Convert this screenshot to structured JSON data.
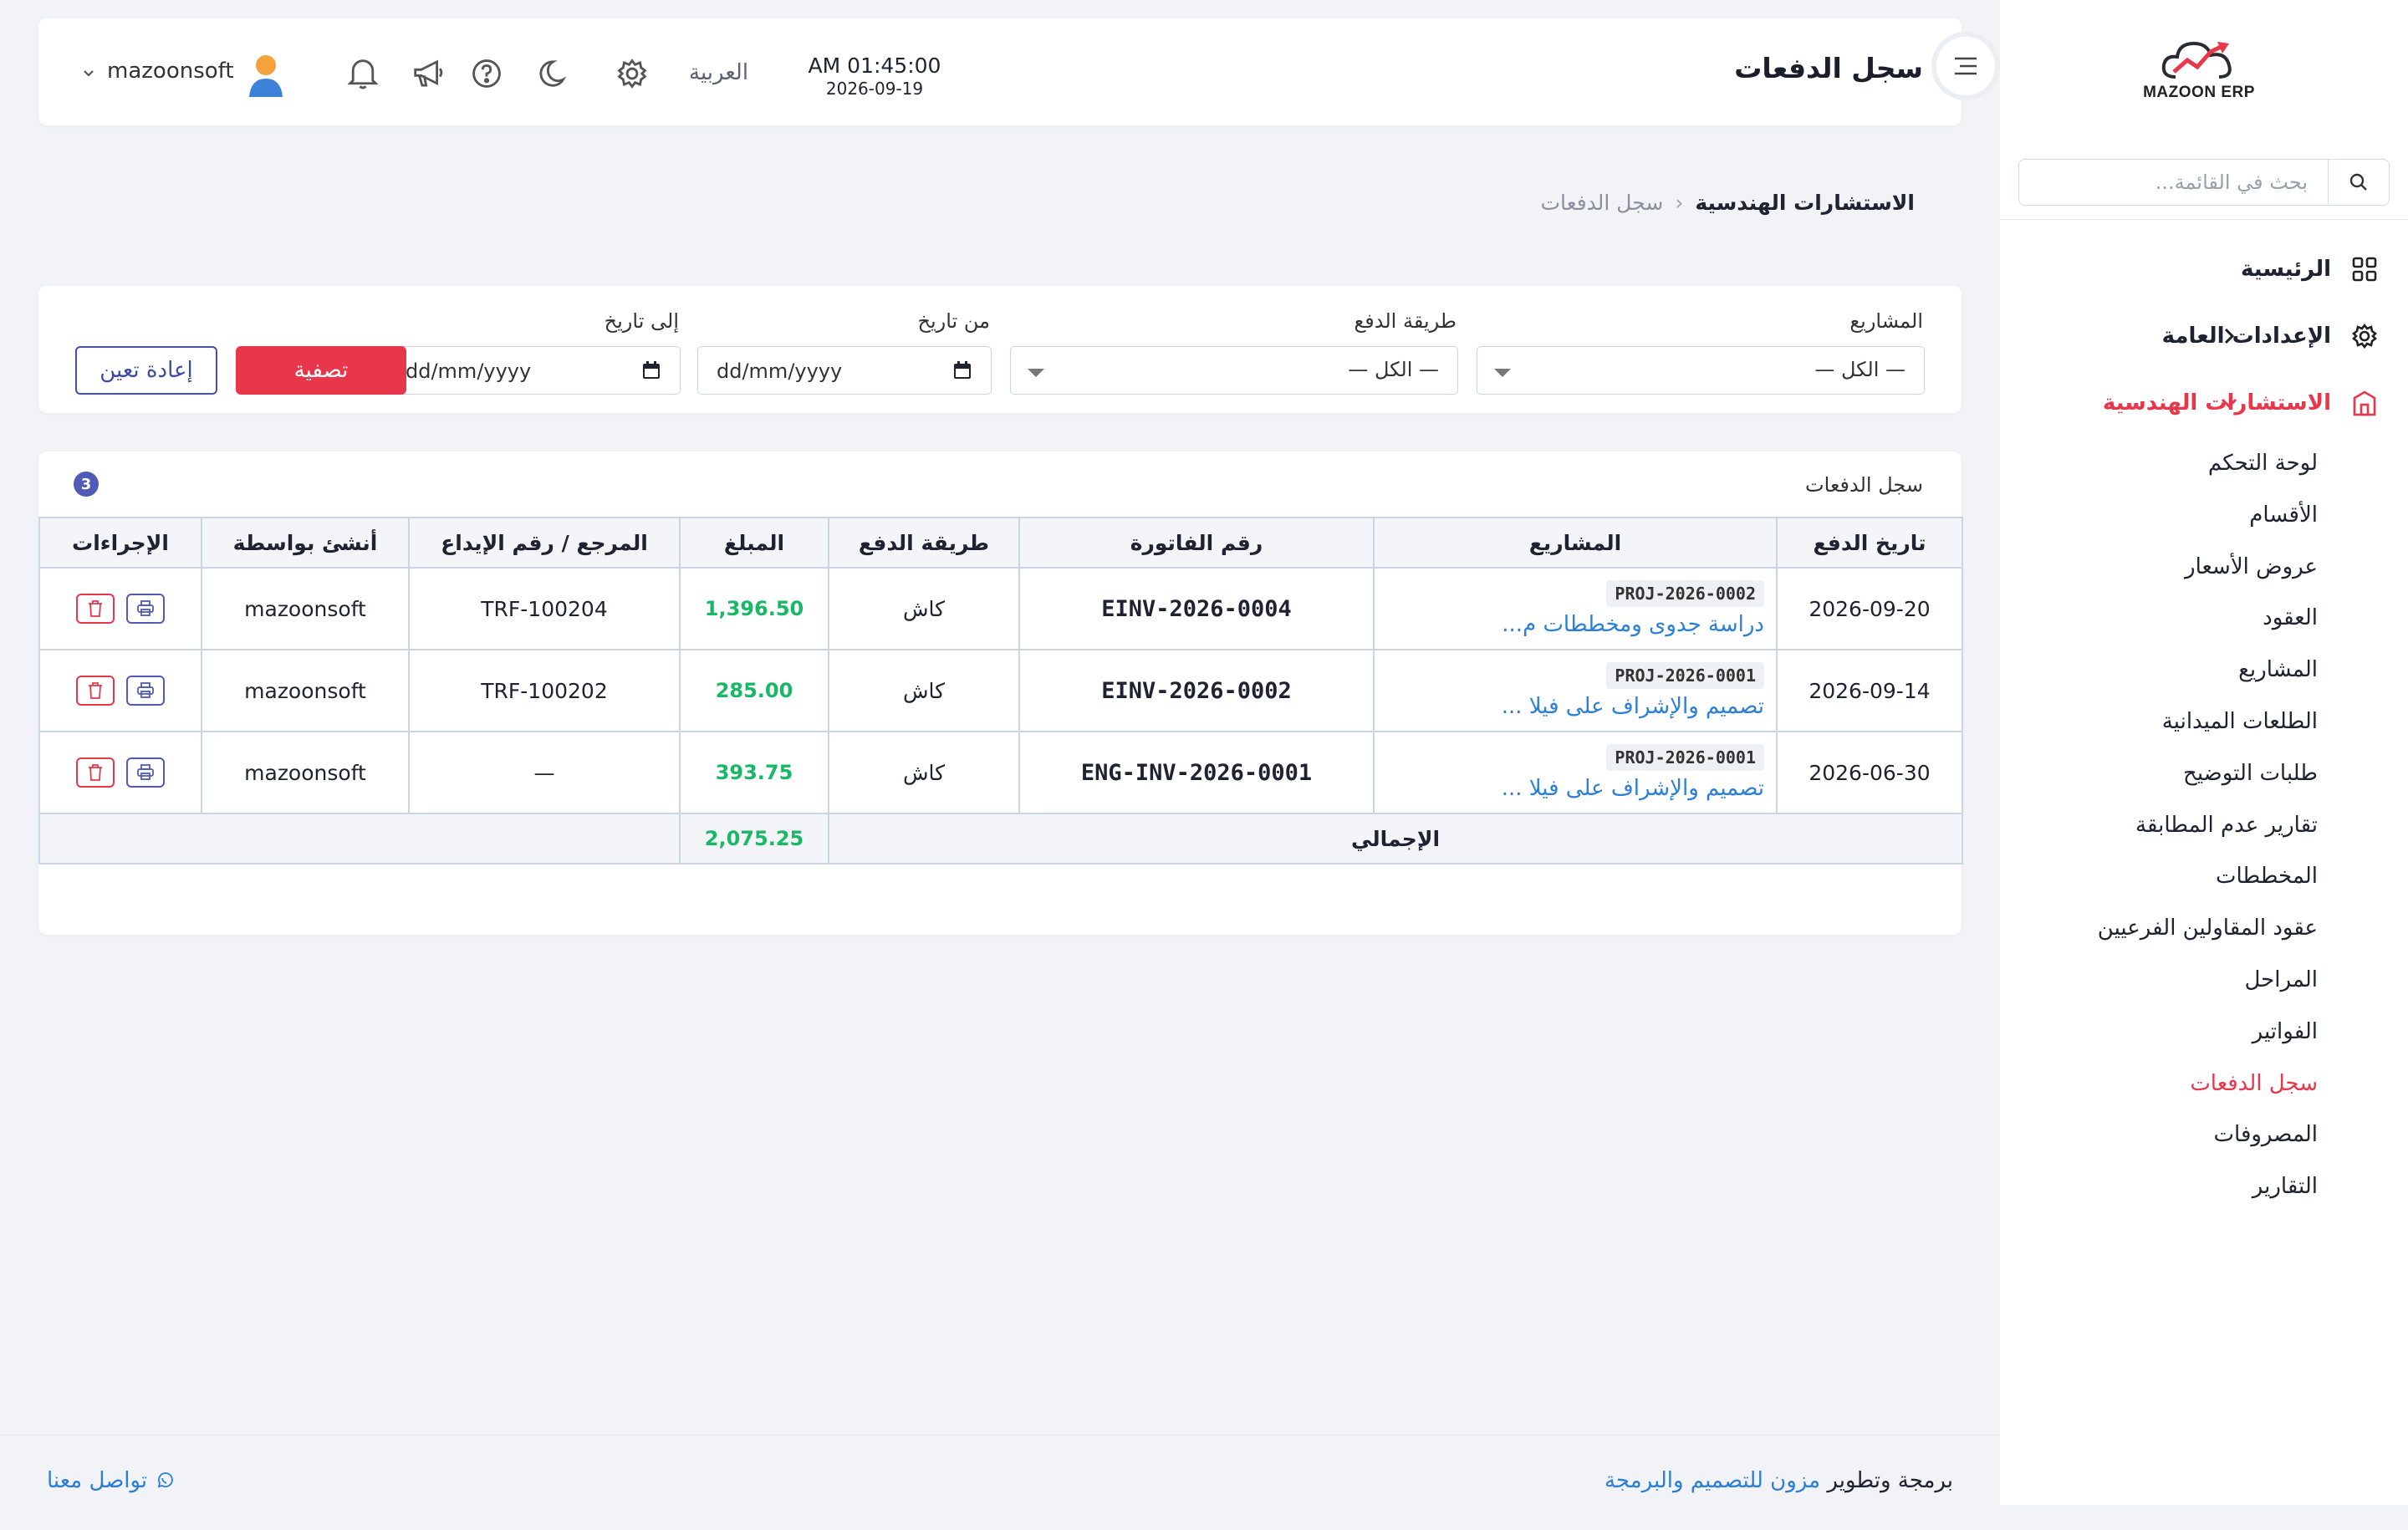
{
  "sidebar": {
    "logo_text": "MAZOON ERP",
    "search_placeholder": "بحث في القائمة...",
    "menu": [
      {
        "label": "الرئيسية",
        "icon": "grid-icon"
      },
      {
        "label": "الإعدادات العامة",
        "icon": "gear-icon"
      },
      {
        "label": "الاستشارات الهندسية",
        "icon": "building-icon"
      }
    ],
    "submenu": [
      "لوحة التحكم",
      "الأقسام",
      "عروض الأسعار",
      "العقود",
      "المشاريع",
      "الطلعات الميدانية",
      "طلبات التوضيح",
      "تقارير عدم المطابقة",
      "المخططات",
      "عقود المقاولين الفرعيين",
      "المراحل",
      "الفواتير",
      "سجل الدفعات",
      "المصروفات",
      "التقارير"
    ],
    "active_submenu_index": 12
  },
  "header": {
    "title": "سجل الدفعات",
    "time": "AM 01:45:00",
    "date": "2026-09-19",
    "language": "العربية",
    "user": "mazoonsoft"
  },
  "breadcrumb": {
    "parent": "الاستشارات الهندسية",
    "separator": "‹",
    "current": "سجل الدفعات"
  },
  "filters": {
    "projects_label": "المشاريع",
    "projects_value": "— الكل —",
    "method_label": "طريقة الدفع",
    "method_value": "— الكل —",
    "from_label": "من تاريخ",
    "from_value": "dd/mm/yyyy",
    "to_label": "إلى تاريخ",
    "to_value": "dd/mm/yyyy",
    "filter_button": "تصفية",
    "reset_button": "إعادة تعين"
  },
  "table": {
    "title": "سجل الدفعات",
    "count": "3",
    "headers": [
      "تاريخ الدفع",
      "المشاريع",
      "رقم الفاتورة",
      "طريقة الدفع",
      "المبلغ",
      "المرجع / رقم الإيداع",
      "أنشئ بواسطة",
      "الإجراءات"
    ],
    "rows": [
      {
        "date": "2026-09-20",
        "project_code": "PROJ-2026-0002",
        "project_name": "دراسة جدوى ومخططات م...",
        "invoice": "EINV-2026-0004",
        "method": "كاش",
        "amount": "1,396.50",
        "reference": "TRF-100204",
        "created_by": "mazoonsoft"
      },
      {
        "date": "2026-09-14",
        "project_code": "PROJ-2026-0001",
        "project_name": "تصميم والإشراف على فيلا ...",
        "invoice": "EINV-2026-0002",
        "method": "كاش",
        "amount": "285.00",
        "reference": "TRF-100202",
        "created_by": "mazoonsoft"
      },
      {
        "date": "2026-06-30",
        "project_code": "PROJ-2026-0001",
        "project_name": "تصميم والإشراف على فيلا ...",
        "invoice": "ENG-INV-2026-0001",
        "method": "كاش",
        "amount": "393.75",
        "reference": "—",
        "created_by": "mazoonsoft"
      }
    ],
    "total_label": "الإجمالي",
    "total_amount": "2,075.25"
  },
  "footer": {
    "prefix": "برمجة وتطوير",
    "company": "مزون للتصميم والبرمجة",
    "contact": "تواصل معنا"
  },
  "colors": {
    "accent": "#e8374a",
    "primary": "#4f5bb5",
    "link": "#2b7fd6",
    "amount": "#18b866"
  }
}
